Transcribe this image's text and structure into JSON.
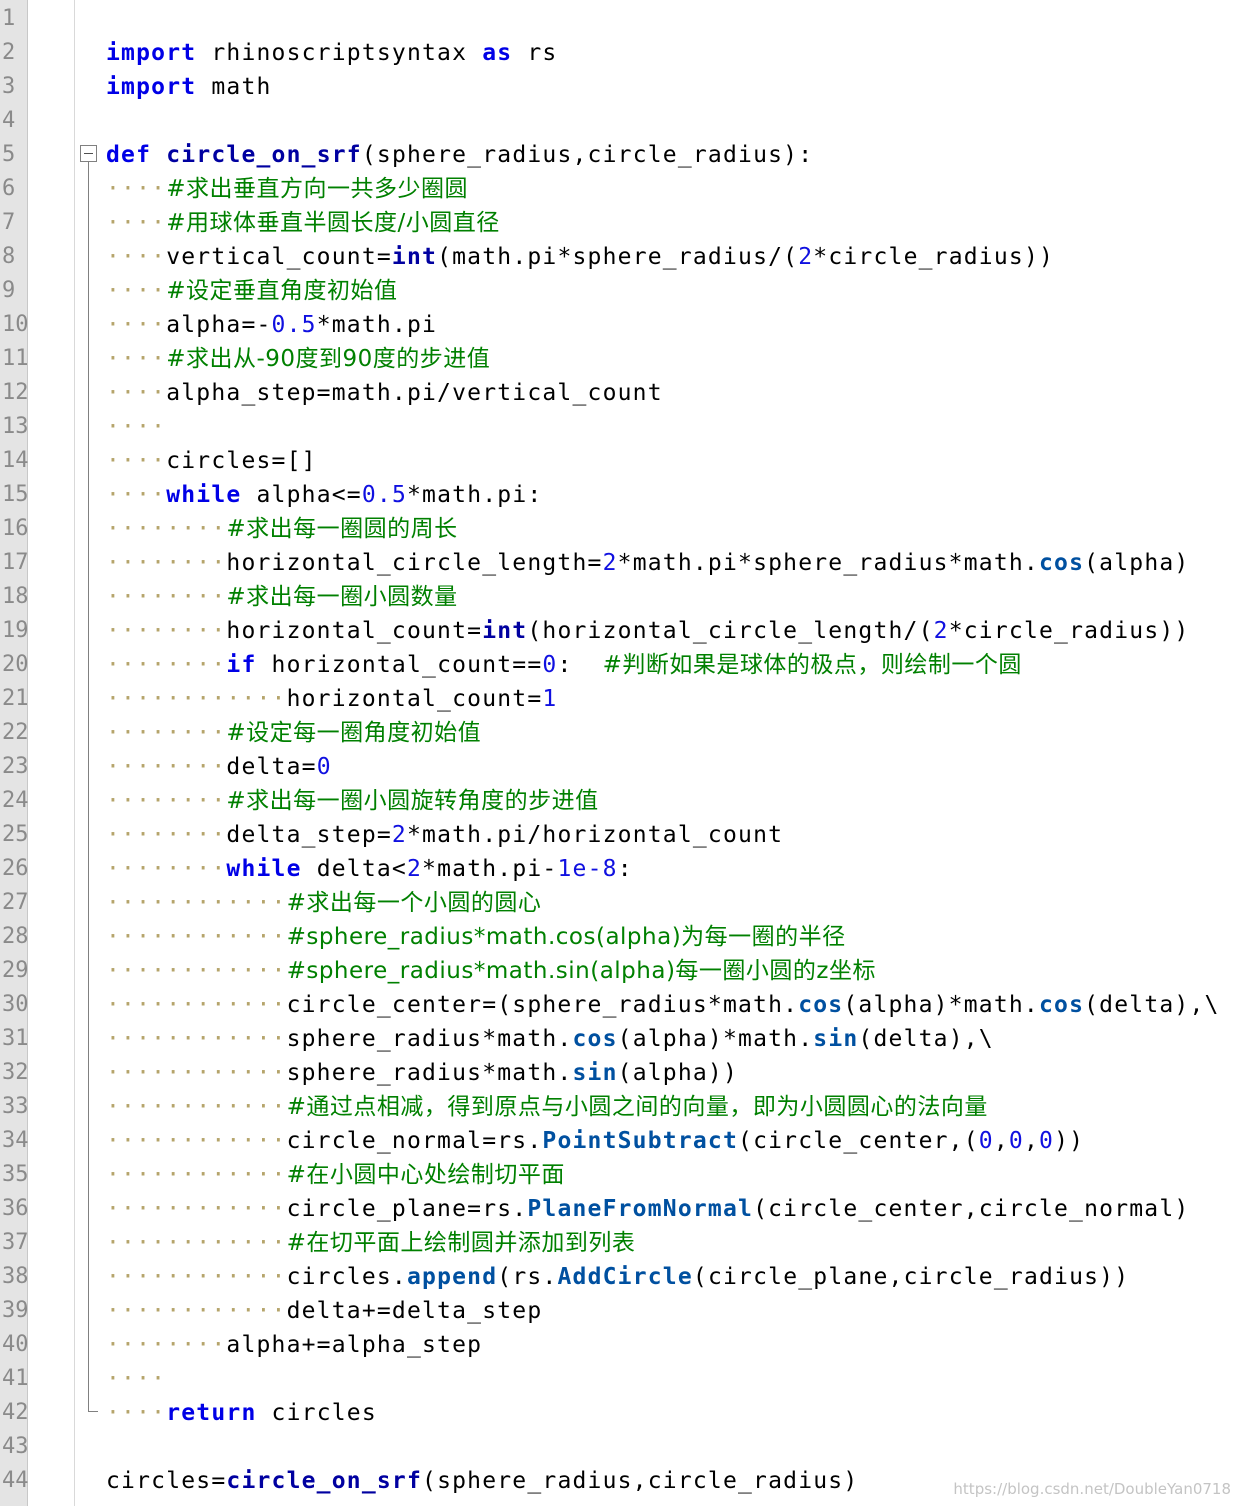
{
  "editor": {
    "line_numbers": [
      "1",
      "2",
      "3",
      "4",
      "5",
      "6",
      "7",
      "8",
      "9",
      "10",
      "11",
      "12",
      "13",
      "14",
      "15",
      "16",
      "17",
      "18",
      "19",
      "20",
      "21",
      "22",
      "23",
      "24",
      "25",
      "26",
      "27",
      "28",
      "29",
      "30",
      "31",
      "32",
      "33",
      "34",
      "35",
      "36",
      "37",
      "38",
      "39",
      "40",
      "41",
      "42",
      "43",
      "44"
    ],
    "lines": [
      [],
      [
        [
          "kw",
          "import"
        ],
        [
          "t",
          " rhinoscriptsyntax "
        ],
        [
          "kw",
          "as"
        ],
        [
          "t",
          " rs"
        ]
      ],
      [
        [
          "kw",
          "import"
        ],
        [
          "t",
          " math"
        ]
      ],
      [],
      [
        [
          "kw",
          "def"
        ],
        [
          "t",
          " "
        ],
        [
          "fn",
          "circle_on_srf"
        ],
        [
          "t",
          "(sphere_radius,circle_radius):"
        ]
      ],
      [
        [
          "ws",
          "····"
        ],
        [
          "cm",
          "#求出垂直方向一共多少圈圆"
        ]
      ],
      [
        [
          "ws",
          "····"
        ],
        [
          "cm",
          "#用球体垂直半圆长度/小圆直径"
        ]
      ],
      [
        [
          "ws",
          "····"
        ],
        [
          "t",
          "vertical_count="
        ],
        [
          "bi",
          "int"
        ],
        [
          "t",
          "(math.pi*sphere_radius/("
        ],
        [
          "num",
          "2"
        ],
        [
          "t",
          "*circle_radius))"
        ]
      ],
      [
        [
          "ws",
          "····"
        ],
        [
          "cm",
          "#设定垂直角度初始值"
        ]
      ],
      [
        [
          "ws",
          "····"
        ],
        [
          "t",
          "alpha=-"
        ],
        [
          "num",
          "0.5"
        ],
        [
          "t",
          "*math.pi"
        ]
      ],
      [
        [
          "ws",
          "····"
        ],
        [
          "cm",
          "#求出从-90度到90度的步进值"
        ]
      ],
      [
        [
          "ws",
          "····"
        ],
        [
          "t",
          "alpha_step=math.pi/vertical_count"
        ]
      ],
      [
        [
          "ws",
          "····"
        ]
      ],
      [
        [
          "ws",
          "····"
        ],
        [
          "t",
          "circles=[]"
        ]
      ],
      [
        [
          "ws",
          "····"
        ],
        [
          "kw",
          "while"
        ],
        [
          "t",
          " alpha<="
        ],
        [
          "num",
          "0.5"
        ],
        [
          "t",
          "*math.pi:"
        ]
      ],
      [
        [
          "ws",
          "········"
        ],
        [
          "cm",
          "#求出每一圈圆的周长"
        ]
      ],
      [
        [
          "ws",
          "········"
        ],
        [
          "t",
          "horizontal_circle_length="
        ],
        [
          "num",
          "2"
        ],
        [
          "t",
          "*math.pi*sphere_radius*math."
        ],
        [
          "at",
          "cos"
        ],
        [
          "t",
          "(alpha)"
        ]
      ],
      [
        [
          "ws",
          "········"
        ],
        [
          "cm",
          "#求出每一圈小圆数量"
        ]
      ],
      [
        [
          "ws",
          "········"
        ],
        [
          "t",
          "horizontal_count="
        ],
        [
          "bi",
          "int"
        ],
        [
          "t",
          "(horizontal_circle_length/("
        ],
        [
          "num",
          "2"
        ],
        [
          "t",
          "*circle_radius))"
        ]
      ],
      [
        [
          "ws",
          "········"
        ],
        [
          "kw",
          "if"
        ],
        [
          "t",
          " horizontal_count=="
        ],
        [
          "num",
          "0"
        ],
        [
          "t",
          ":  "
        ],
        [
          "cm",
          "#判断如果是球体的极点，则绘制一个圆"
        ]
      ],
      [
        [
          "ws",
          "············"
        ],
        [
          "t",
          "horizontal_count="
        ],
        [
          "num",
          "1"
        ]
      ],
      [
        [
          "ws",
          "········"
        ],
        [
          "cm",
          "#设定每一圈角度初始值"
        ]
      ],
      [
        [
          "ws",
          "········"
        ],
        [
          "t",
          "delta="
        ],
        [
          "num",
          "0"
        ]
      ],
      [
        [
          "ws",
          "········"
        ],
        [
          "cm",
          "#求出每一圈小圆旋转角度的步进值"
        ]
      ],
      [
        [
          "ws",
          "········"
        ],
        [
          "t",
          "delta_step="
        ],
        [
          "num",
          "2"
        ],
        [
          "t",
          "*math.pi/horizontal_count"
        ]
      ],
      [
        [
          "ws",
          "········"
        ],
        [
          "kw",
          "while"
        ],
        [
          "t",
          " delta<"
        ],
        [
          "num",
          "2"
        ],
        [
          "t",
          "*math.pi-"
        ],
        [
          "num",
          "1e-8"
        ],
        [
          "t",
          ":"
        ]
      ],
      [
        [
          "ws",
          "············"
        ],
        [
          "cm",
          "#求出每一个小圆的圆心"
        ]
      ],
      [
        [
          "ws",
          "············"
        ],
        [
          "cm",
          "#sphere_radius*math.cos(alpha)为每一圈的半径"
        ]
      ],
      [
        [
          "ws",
          "············"
        ],
        [
          "cm",
          "#sphere_radius*math.sin(alpha)每一圈小圆的z坐标"
        ]
      ],
      [
        [
          "ws",
          "············"
        ],
        [
          "t",
          "circle_center=(sphere_radius*math."
        ],
        [
          "at",
          "cos"
        ],
        [
          "t",
          "(alpha)*math."
        ],
        [
          "at",
          "cos"
        ],
        [
          "t",
          "(delta),\\"
        ]
      ],
      [
        [
          "ws",
          "············"
        ],
        [
          "t",
          "sphere_radius*math."
        ],
        [
          "at",
          "cos"
        ],
        [
          "t",
          "(alpha)*math."
        ],
        [
          "at",
          "sin"
        ],
        [
          "t",
          "(delta),\\"
        ]
      ],
      [
        [
          "ws",
          "············"
        ],
        [
          "t",
          "sphere_radius*math."
        ],
        [
          "at",
          "sin"
        ],
        [
          "t",
          "(alpha))"
        ]
      ],
      [
        [
          "ws",
          "············"
        ],
        [
          "cm",
          "#通过点相减，得到原点与小圆之间的向量，即为小圆圆心的法向量"
        ]
      ],
      [
        [
          "ws",
          "············"
        ],
        [
          "t",
          "circle_normal=rs."
        ],
        [
          "at",
          "PointSubtract"
        ],
        [
          "t",
          "(circle_center,("
        ],
        [
          "num",
          "0"
        ],
        [
          "t",
          ","
        ],
        [
          "num",
          "0"
        ],
        [
          "t",
          ","
        ],
        [
          "num",
          "0"
        ],
        [
          "t",
          "))"
        ]
      ],
      [
        [
          "ws",
          "············"
        ],
        [
          "cm",
          "#在小圆中心处绘制切平面"
        ]
      ],
      [
        [
          "ws",
          "············"
        ],
        [
          "t",
          "circle_plane=rs."
        ],
        [
          "at",
          "PlaneFromNormal"
        ],
        [
          "t",
          "(circle_center,circle_normal)"
        ]
      ],
      [
        [
          "ws",
          "············"
        ],
        [
          "cm",
          "#在切平面上绘制圆并添加到列表"
        ]
      ],
      [
        [
          "ws",
          "············"
        ],
        [
          "t",
          "circles."
        ],
        [
          "at",
          "append"
        ],
        [
          "t",
          "(rs."
        ],
        [
          "at",
          "AddCircle"
        ],
        [
          "t",
          "(circle_plane,circle_radius))"
        ]
      ],
      [
        [
          "ws",
          "············"
        ],
        [
          "t",
          "delta+=delta_step"
        ]
      ],
      [
        [
          "ws",
          "········"
        ],
        [
          "t",
          "alpha+=alpha_step"
        ]
      ],
      [
        [
          "ws",
          "····"
        ]
      ],
      [
        [
          "ws",
          "····"
        ],
        [
          "kw",
          "return"
        ],
        [
          "t",
          " circles"
        ]
      ],
      [],
      [
        [
          "t",
          "circles="
        ],
        [
          "fn",
          "circle_on_srf"
        ],
        [
          "t",
          "(sphere_radius,circle_radius)"
        ]
      ]
    ]
  },
  "watermark": "https://blog.csdn.net/DoubleYan0718",
  "colors": {
    "keyword": "#0000e6",
    "comment": "#008000",
    "number": "#1010e0",
    "whitespace_marker": "#b5a46b",
    "gutter": "#e4e4e4"
  }
}
